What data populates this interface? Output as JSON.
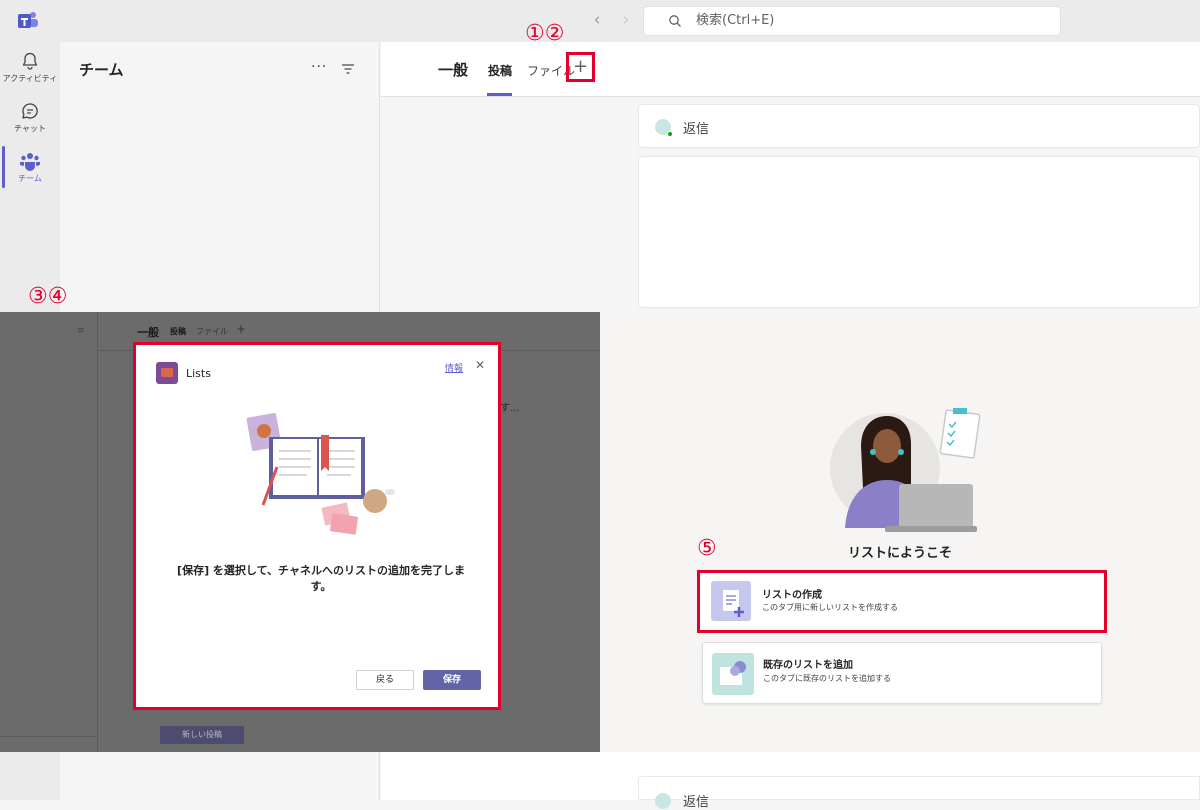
{
  "topbar": {
    "search_placeholder": "検索(Ctrl+E)",
    "back_icon": "chevron-left-icon",
    "forward_icon": "chevron-right-icon"
  },
  "rail": {
    "items": [
      {
        "label": "アクティビティ",
        "icon": "bell-icon"
      },
      {
        "label": "チャット",
        "icon": "chat-icon"
      },
      {
        "label": "チーム",
        "icon": "teams-icon"
      }
    ]
  },
  "team_pane": {
    "title": "チーム",
    "more": "···"
  },
  "channel": {
    "title": "一般",
    "tabs": [
      {
        "label": "投稿"
      },
      {
        "label": "ファイル"
      }
    ],
    "add_tab": "+",
    "reply_label": "返信"
  },
  "annotations": {
    "steps_1_2": "①②",
    "steps_3_4": "③④",
    "step_5": "⑤"
  },
  "dim_panel": {
    "channel_title": "一般",
    "tab_posts": "投稿",
    "tab_files": "ファイル",
    "add_tab": "+",
    "ellipsis": "す...",
    "new_post": "新しい投稿"
  },
  "dialog": {
    "app_name": "Lists",
    "info_link": "情報",
    "close": "✕",
    "message": "[保存] を選択して、チャネルへのリストの追加を完了します。",
    "back_label": "戻る",
    "save_label": "保存"
  },
  "welcome": {
    "title": "リストにようこそ",
    "options": [
      {
        "title": "リストの作成",
        "description": "このタブ用に新しいリストを作成する"
      },
      {
        "title": "既存のリストを追加",
        "description": "このタブに既存のリストを追加する"
      }
    ]
  },
  "bottom": {
    "reply_label": "返信"
  },
  "colors": {
    "accent": "#5b5fc7",
    "highlight": "#e0002b",
    "save_button": "#6264a7"
  }
}
